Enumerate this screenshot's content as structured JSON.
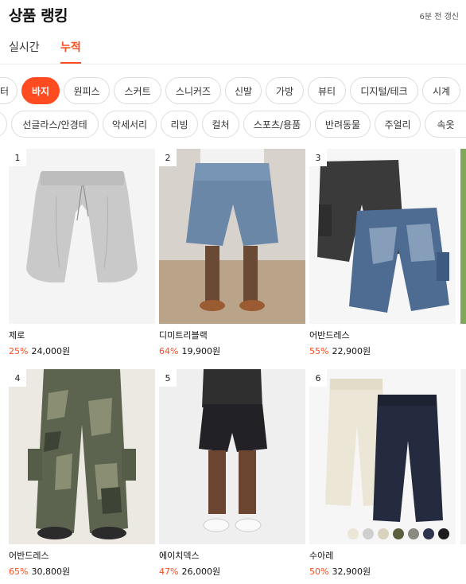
{
  "header": {
    "title": "상품 랭킹",
    "updated": "6분 전 갱신"
  },
  "tabs": [
    {
      "label": "실시간"
    },
    {
      "label": "누적"
    }
  ],
  "categories_row1": [
    {
      "label": "터"
    },
    {
      "label": "바지"
    },
    {
      "label": "원피스"
    },
    {
      "label": "스커트"
    },
    {
      "label": "스니커즈"
    },
    {
      "label": "신발"
    },
    {
      "label": "가방"
    },
    {
      "label": "뷰티"
    },
    {
      "label": "디지털/테크"
    },
    {
      "label": "시계"
    }
  ],
  "categories_row2": [
    {
      "label": "선글라스/안경테"
    },
    {
      "label": "악세서리"
    },
    {
      "label": "리빙"
    },
    {
      "label": "컬처"
    },
    {
      "label": "스포츠/용품"
    },
    {
      "label": "반려동물"
    },
    {
      "label": "주얼리"
    },
    {
      "label": "속옷"
    }
  ],
  "products": [
    {
      "rank": "1",
      "name": "제로",
      "discount": "25%",
      "price": "24,000원"
    },
    {
      "rank": "2",
      "name": "디미트리블랙",
      "discount": "64%",
      "price": "19,900원"
    },
    {
      "rank": "3",
      "name": "어반드레스",
      "discount": "55%",
      "price": "22,900원"
    },
    {
      "rank": "4",
      "name": "어반드레스",
      "discount": "65%",
      "price": "30,800원"
    },
    {
      "rank": "5",
      "name": "에이치덱스",
      "discount": "47%",
      "price": "26,000원"
    },
    {
      "rank": "6",
      "name": "수아레",
      "discount": "50%",
      "price": "32,900원"
    }
  ],
  "swatch_colors": [
    "#ece6d6",
    "#cfcfcf",
    "#d9d3bd",
    "#5b5f3d",
    "#8a8a80",
    "#2d3550",
    "#1d1d1f"
  ],
  "colors": {
    "accent": "#ff4b1f"
  }
}
